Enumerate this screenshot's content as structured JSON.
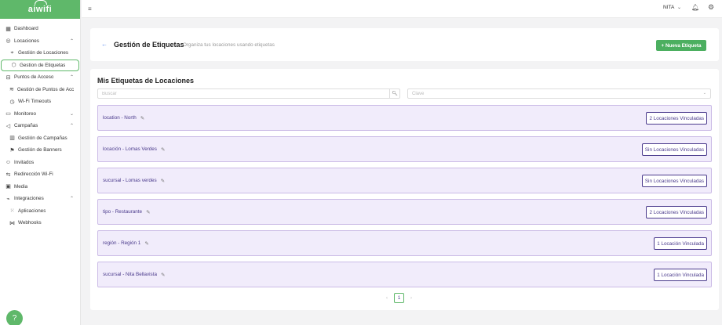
{
  "app": {
    "logo_text": "aiwifi"
  },
  "sidebar": {
    "items": [
      {
        "label": "Dashboard",
        "icon": "dashboard-icon",
        "type": "top"
      },
      {
        "label": "Locaciones",
        "icon": "location-pin-icon",
        "type": "group",
        "expanded": true
      },
      {
        "label": "Gestión de Locaciones",
        "icon": "pin-icon",
        "type": "sub"
      },
      {
        "label": "Gestion de Etiquetas",
        "icon": "tag-icon",
        "type": "sub",
        "active": true
      },
      {
        "label": "Puntos de Acceso",
        "icon": "router-icon",
        "type": "group",
        "expanded": true
      },
      {
        "label": "Gestión de Puntos de Acceso",
        "icon": "wifi-icon",
        "type": "sub"
      },
      {
        "label": "Wi-Fi Timeouts",
        "icon": "clock-icon",
        "type": "sub"
      },
      {
        "label": "Monitoreo",
        "icon": "monitor-icon",
        "type": "group",
        "expanded": false
      },
      {
        "label": "Campañas",
        "icon": "megaphone-icon",
        "type": "group",
        "expanded": true
      },
      {
        "label": "Gestión de Campañas",
        "icon": "chart-icon",
        "type": "sub"
      },
      {
        "label": "Gestión de Banners",
        "icon": "flag-icon",
        "type": "sub"
      },
      {
        "label": "Invitados",
        "icon": "users-icon",
        "type": "top"
      },
      {
        "label": "Redirección Wi-Fi",
        "icon": "redirect-icon",
        "type": "top"
      },
      {
        "label": "Media",
        "icon": "image-icon",
        "type": "top"
      },
      {
        "label": "Integraciones",
        "icon": "plug-icon",
        "type": "group",
        "expanded": true
      },
      {
        "label": "Aplicaciones",
        "icon": "grid-icon",
        "type": "sub"
      },
      {
        "label": "Webhooks",
        "icon": "webhook-icon",
        "type": "sub"
      }
    ]
  },
  "topbar": {
    "user_name": "NITA"
  },
  "header": {
    "title": "Gestión de Etiquetas",
    "subtitle": "Organiza tus locaciones usando etiquetas",
    "new_button": "+ Nueva Etiqueta"
  },
  "main": {
    "section_title": "Mis Etiquetas de Locaciones",
    "search_placeholder": "Buscar",
    "key_placeholder": "Clave",
    "tags": [
      {
        "name": "location - North",
        "linked": "2 Locaciones Vinculadas"
      },
      {
        "name": "locación - Lomas Verdes",
        "linked": "Sin Locaciones Vinculadas"
      },
      {
        "name": "sucursal - Lomas verdes",
        "linked": "Sin Locaciones Vinculadas"
      },
      {
        "name": "tipo - Restaurante",
        "linked": "2 Locaciones Vinculadas"
      },
      {
        "name": "región - Región 1",
        "linked": "1 Locación Vinculada"
      },
      {
        "name": "sucursal - Nita Bellavista",
        "linked": "1 Locación Vinculada"
      }
    ],
    "pagination": {
      "current": "1"
    }
  },
  "colors": {
    "brand_green": "#5fb86a",
    "tag_bg": "#f1ecfb",
    "tag_text": "#4a3a8c"
  }
}
